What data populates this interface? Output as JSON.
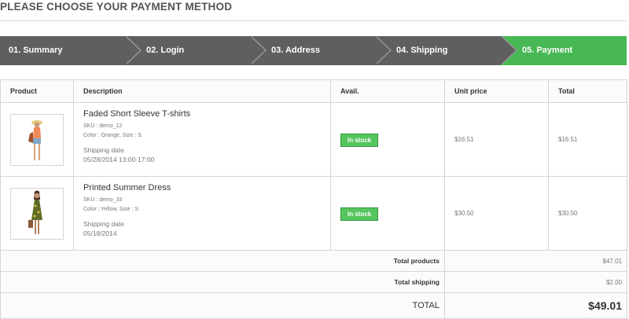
{
  "page": {
    "heading": "PLEASE CHOOSE YOUR PAYMENT METHOD"
  },
  "steps": [
    {
      "label": "01. Summary",
      "state": "done"
    },
    {
      "label": "02. Login",
      "state": "done"
    },
    {
      "label": "03. Address",
      "state": "done"
    },
    {
      "label": "04. Shipping",
      "state": "done"
    },
    {
      "label": "05. Payment",
      "state": "current"
    }
  ],
  "colors": {
    "step_done": "#5f5f5f",
    "step_current": "#47b853",
    "in_stock": "#55c65e"
  },
  "cart": {
    "headers": {
      "product": "Product",
      "description": "Description",
      "avail": "Avail.",
      "unit_price": "Unit price",
      "total": "Total"
    },
    "items": [
      {
        "name": "Faded Short Sleeve T-shirts",
        "sku": "SKU : demo_12",
        "attributes": "Color : Orange, Size : S",
        "shipping_label": "Shipping date",
        "shipping_date": "05/28/2014 13:00-17:00",
        "availability": "In stock",
        "unit_price": "$16.51",
        "total": "$16.51"
      },
      {
        "name": "Printed Summer Dress",
        "sku": "SKU : demo_33",
        "attributes": "Color : Yellow, Size : S",
        "shipping_label": "Shipping date",
        "shipping_date": "05/18/2014",
        "availability": "In stock",
        "unit_price": "$30.50",
        "total": "$30.50"
      }
    ],
    "summary": {
      "total_products_label": "Total products",
      "total_products": "$47.01",
      "total_shipping_label": "Total shipping",
      "total_shipping": "$2.00",
      "total_label": "TOTAL",
      "total": "$49.01"
    }
  }
}
